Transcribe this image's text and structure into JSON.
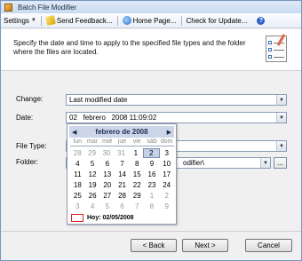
{
  "window": {
    "title": "Batch File Modifier"
  },
  "menu": {
    "settings": "Settings",
    "send_feedback": "Send Feedback...",
    "home_page": "Home Page...",
    "check_updates": "Check for Update..."
  },
  "header": {
    "instructions": "Specify the date and time to apply to the specified file types and the folder where the files are located."
  },
  "form": {
    "change_label": "Change:",
    "change_value": "Last modified date",
    "date_label": "Date:",
    "date_value": "02   febrero   2008 11:09:02",
    "filetype_label": "File Type:",
    "folder_label": "Folder:",
    "folder_value": "odifier\\",
    "browse_label": "..."
  },
  "calendar": {
    "month_label": "febrero de 2008",
    "weekdays": [
      "lun",
      "mar",
      "mié",
      "jue",
      "vie",
      "sáb",
      "dom"
    ],
    "weeks": [
      [
        "28",
        "29",
        "30",
        "31",
        "1",
        "2",
        "3"
      ],
      [
        "4",
        "5",
        "6",
        "7",
        "8",
        "9",
        "10"
      ],
      [
        "11",
        "12",
        "13",
        "14",
        "15",
        "16",
        "17"
      ],
      [
        "18",
        "19",
        "20",
        "21",
        "22",
        "23",
        "24"
      ],
      [
        "25",
        "26",
        "27",
        "28",
        "29",
        "1",
        "2"
      ],
      [
        "3",
        "4",
        "5",
        "6",
        "7",
        "8",
        "9"
      ]
    ],
    "selected_day": "2",
    "today_label": "Hoy: 02/05/2008"
  },
  "buttons": {
    "back": "< Back",
    "next": "Next >",
    "cancel": "Cancel"
  },
  "colors": {
    "titlebar": "#c9dbf1",
    "calendar_header": "#ccd6e8",
    "today_marker": "#dd2222"
  }
}
